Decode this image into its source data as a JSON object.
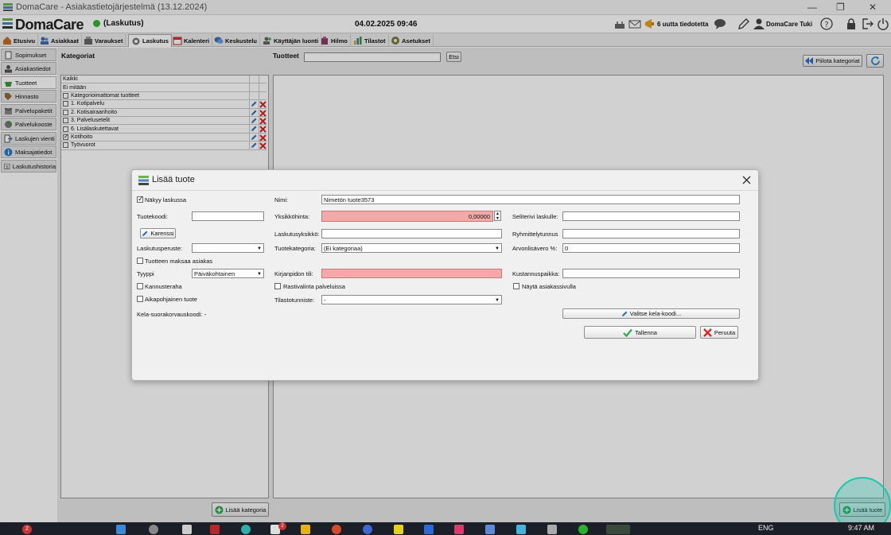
{
  "window": {
    "title": "DomaCare - Asiakastietojärjestelmä (13.12.2024)",
    "minimize": "—",
    "maximize": "❐",
    "close": "✕"
  },
  "header": {
    "logo": "DomaCare",
    "status": "(Laskutus)",
    "datetime": "04.02.2025 09:46",
    "notifications": "6 uutta tiedotetta",
    "user": "DomaCare Tuki"
  },
  "menu": [
    {
      "label": "Etusivu"
    },
    {
      "label": "Asiakkaat"
    },
    {
      "label": "Varaukset"
    },
    {
      "label": "Laskutus"
    },
    {
      "label": "Kalenteri"
    },
    {
      "label": "Keskustelu"
    },
    {
      "label": "Käyttäjän luonti"
    },
    {
      "label": "Hilmo"
    },
    {
      "label": "Tilastot"
    },
    {
      "label": "Asetukset"
    }
  ],
  "sidebar": [
    {
      "label": "Sopimukset"
    },
    {
      "label": "Asiakastiedot"
    },
    {
      "label": "Tuotteet"
    },
    {
      "label": "Hinnasto"
    },
    {
      "label": "Palvelupaketit"
    },
    {
      "label": "Palvelukooste"
    },
    {
      "label": "Laskujen vienti"
    },
    {
      "label": "Maksajatiedot"
    },
    {
      "label": "Laskutushistoria"
    }
  ],
  "categories": {
    "title": "Kategoriat",
    "rows": [
      {
        "label": "Kaikki"
      },
      {
        "label": "Ei mitään"
      },
      {
        "label": "Kategorioimattomat tuotteet"
      },
      {
        "label": "1. Kotipalvelu"
      },
      {
        "label": "2. Kotisairaanhoito"
      },
      {
        "label": "3. Palvelusetelit"
      },
      {
        "label": "6. Lisälaskutettavat"
      },
      {
        "label": "Kotihoito"
      },
      {
        "label": "Työvuorot"
      }
    ],
    "add_button": "Lisää kategoria"
  },
  "products": {
    "title": "Tuotteet",
    "search_value": "",
    "search_button": "Etsi",
    "hide_categories": "Piilota kategoriat",
    "add_product": "Lisää tuote"
  },
  "modal": {
    "title": "Lisää tuote",
    "visible_on_invoice": "Näkyy laskussa",
    "product_code_label": "Tuotekoodi:",
    "product_code_value": "",
    "exemption_button": "Karenssi",
    "billing_basis_label": "Laskutusperuste:",
    "billing_basis_value": "",
    "customer_pays": "Tuotteen maksaa asiakas",
    "type_label": "Tyyppi",
    "type_value": "Päiväkohtainen",
    "incentive": "Kannusteraha",
    "time_based": "Aikapohjainen tuote",
    "kela_label": "Kela-suorakorvauskoodi: -",
    "name_label": "Nimi:",
    "name_value": "Nimetön tuote3573",
    "unit_price_label": "Yksikköhinta:",
    "unit_price_value": "0,00000",
    "billing_unit_label": "Laskutusyksikkö:",
    "billing_unit_value": "",
    "category_label": "Tuotekategoria:",
    "category_value": "(Ei kategoriaa)",
    "ledger_label": "Kirjanpidon tili:",
    "ledger_value": "",
    "checkbox_service": "Rastivalinta palveluissa",
    "stat_code_label": "Tilastotunniste:",
    "stat_code_value": "-",
    "explanation_label": "Selite­rivi laskulle:",
    "explanation_value": "",
    "group_label": "Ryhmittelytunnus",
    "group_value": "",
    "vat_label": "Arvonlisävero %:",
    "vat_value": "0",
    "cost_center_label": "Kustannuspaikka:",
    "cost_center_value": "",
    "show_customer_page": "Näytä asiakassivulla",
    "select_kela": "Valitse kela-koodi...",
    "save": "Tallenna",
    "cancel": "Peruuta"
  },
  "taskbar": {
    "lang": "ENG",
    "badge1": "2",
    "badge2": "2",
    "time": "9:47 AM"
  }
}
